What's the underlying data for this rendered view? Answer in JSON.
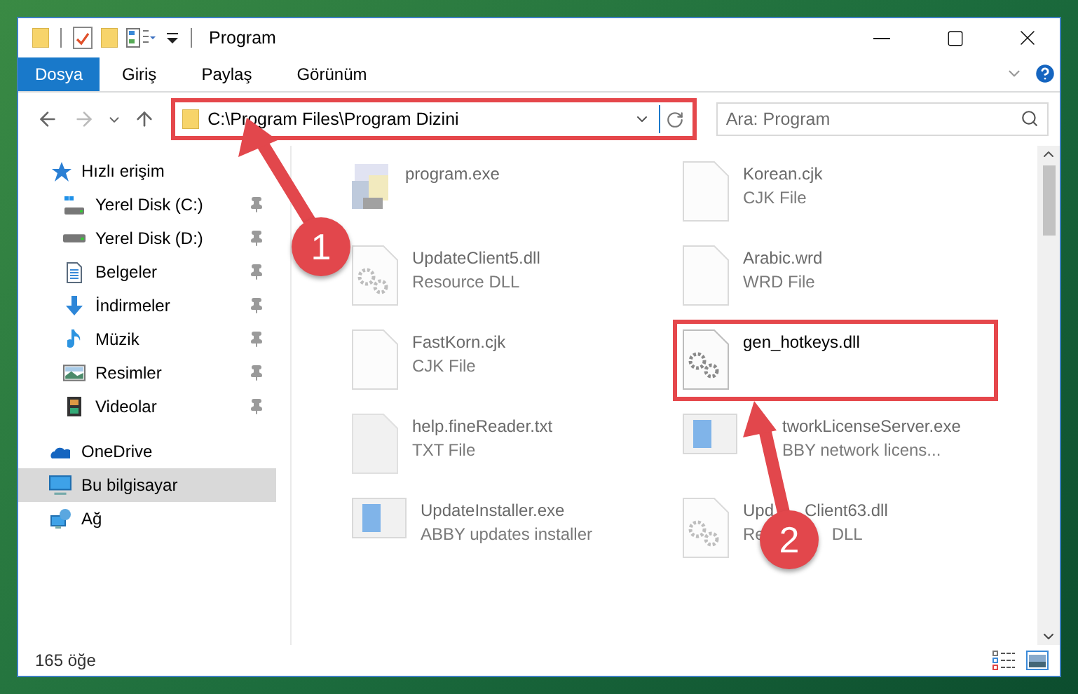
{
  "window": {
    "title": "Program"
  },
  "ribbon_tabs": [
    {
      "label": "Dosya",
      "selected": true
    },
    {
      "label": "Giriş",
      "selected": false
    },
    {
      "label": "Paylaş",
      "selected": false
    },
    {
      "label": "Görünüm",
      "selected": false
    }
  ],
  "address_bar": {
    "path": "C:\\Program Files\\Program Dizini",
    "highlighted": true
  },
  "search": {
    "placeholder": "Ara: Program"
  },
  "sidebar": {
    "items": [
      {
        "label": "Hızlı erişim",
        "kind": "star",
        "selected": false,
        "children": [
          {
            "label": "Yerel Disk (C:)",
            "kind": "system-drive",
            "pinned": true,
            "selected": false
          },
          {
            "label": "Yerel Disk (D:)",
            "kind": "drive",
            "pinned": true,
            "selected": false
          },
          {
            "label": "Belgeler",
            "kind": "document",
            "pinned": true,
            "selected": false
          },
          {
            "label": "İndirmeler",
            "kind": "download",
            "pinned": true,
            "selected": false
          },
          {
            "label": "Müzik",
            "kind": "music",
            "pinned": true,
            "selected": false
          },
          {
            "label": "Resimler",
            "kind": "image",
            "pinned": true,
            "selected": false
          },
          {
            "label": "Videolar",
            "kind": "film",
            "pinned": true,
            "selected": false
          }
        ]
      },
      {
        "label": "OneDrive",
        "kind": "cloud",
        "selected": false
      },
      {
        "label": "Bu bilgisayar",
        "kind": "computer",
        "selected": true
      },
      {
        "label": "Ağ",
        "kind": "network",
        "selected": false
      }
    ]
  },
  "files": [
    {
      "name": [
        {
          "text": "program.exe"
        }
      ],
      "kind": "exe",
      "faded": true,
      "highlighted": false
    },
    {
      "name": [
        {
          "text": "Korean.cjk"
        }
      ],
      "type": [
        {
          "text": "CJK File"
        }
      ],
      "kind": "blank",
      "faded": true,
      "highlighted": false
    },
    {
      "name": [
        {
          "text": "UpdateClient5.dll"
        }
      ],
      "type": [
        {
          "text": "Resource DLL"
        }
      ],
      "kind": "dll",
      "faded": true,
      "highlighted": false
    },
    {
      "name": [
        {
          "text": "Arabic.wrd"
        }
      ],
      "type": [
        {
          "text": "WRD File"
        }
      ],
      "kind": "blank",
      "faded": true,
      "highlighted": false
    },
    {
      "name": [
        {
          "text": "FastKorn.cjk"
        }
      ],
      "type": [
        {
          "text": "CJK File"
        }
      ],
      "kind": "blank",
      "faded": true,
      "highlighted": false
    },
    {
      "name": [
        {
          "text": "gen_hotkeys.dll"
        }
      ],
      "kind": "dll",
      "faded": false,
      "highlighted": true
    },
    {
      "name": [
        {
          "text": "help.fineReader.txt"
        }
      ],
      "type": [
        {
          "text": "TXT File"
        }
      ],
      "kind": "text",
      "faded": true,
      "highlighted": false
    },
    {
      "name": [
        {
          "text": "tworkLicenseServer.exe",
          "covered_before": true
        }
      ],
      "type": [
        {
          "text": "BBY network licens...",
          "covered_before": true
        }
      ],
      "kind": "installer",
      "faded": true,
      "highlighted": false
    },
    {
      "name": [
        {
          "text": "UpdateInstaller.exe"
        }
      ],
      "type": [
        {
          "text": "ABBY updates installer"
        }
      ],
      "kind": "installer",
      "faded": true,
      "highlighted": false
    },
    {
      "name": [
        {
          "text": "Upd"
        },
        {
          "text": "Client63.dll",
          "covered_before": true
        }
      ],
      "type": [
        {
          "text": "Re"
        },
        {
          "text": "DLL",
          "covered_before": true
        }
      ],
      "kind": "dll",
      "faded": true,
      "highlighted": false
    }
  ],
  "status_bar": {
    "item_count": "165 öğe"
  },
  "annotations": [
    {
      "label": "1"
    },
    {
      "label": "2"
    }
  ]
}
